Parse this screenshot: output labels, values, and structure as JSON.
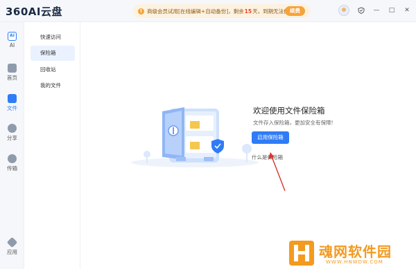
{
  "app": {
    "logo_text": "360AI云盘"
  },
  "promo": {
    "icon": "!",
    "text_before": "商级会员试用[在线编辑+自动备份]，剩余",
    "days": "15",
    "text_after": "天，到期无法使用。",
    "button": "续费"
  },
  "window_controls": {
    "avatar": "user-avatar",
    "shield": "shield-icon",
    "minimize": "—",
    "maximize": "□",
    "close": "✕"
  },
  "rail": {
    "items": [
      {
        "label": "AI",
        "icon": "ai-icon"
      },
      {
        "label": "首页",
        "icon": "home-icon"
      },
      {
        "label": "文件",
        "icon": "folder-icon",
        "active": true
      },
      {
        "label": "分享",
        "icon": "share-icon"
      },
      {
        "label": "传输",
        "icon": "cloud-transfer-icon"
      },
      {
        "label": "应用",
        "icon": "apps-icon"
      }
    ]
  },
  "subnav": {
    "items": [
      {
        "label": "快速访问"
      },
      {
        "label": "保险箱",
        "active": true
      },
      {
        "label": "回收站"
      },
      {
        "label": "我的文件"
      }
    ]
  },
  "vault": {
    "title": "欢迎使用文件保险箱",
    "subtitle": "文件存入保险箱，更加安全有保障!",
    "enable_button": "启用保险箱",
    "what_link": "什么是保险箱"
  },
  "watermark": {
    "text": "魂网软件园",
    "url": "WWW.HNWDW.COM"
  },
  "colors": {
    "accent": "#2f7cf6",
    "promo_bg": "#fdf2e0",
    "promo_button": "#f7a23a",
    "arrow": "#d9342b",
    "watermark": "#f39a1f"
  }
}
